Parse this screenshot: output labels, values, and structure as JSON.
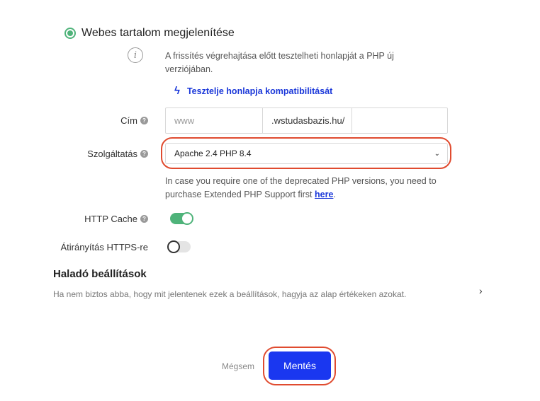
{
  "content_option": {
    "label": "Webes tartalom megjelenítése",
    "selected": true
  },
  "info": {
    "icon": "info-icon",
    "text": "A frissítés végrehajtása előtt tesztelheti honlapját a PHP új verziójában."
  },
  "compat_link": {
    "icon": "lightning-icon",
    "label": "Tesztelje honlapja kompatibilitását"
  },
  "cim": {
    "label": "Cím",
    "subdomain_placeholder": "www",
    "domain": ".wstudasbazis.hu/"
  },
  "service": {
    "label": "Szolgáltatás",
    "selected": "Apache 2.4 PHP 8.4"
  },
  "deprecated_note": {
    "text": "In case you require one of the deprecated PHP versions, you need to purchase Extended PHP Support first ",
    "link": "here",
    "end": "."
  },
  "http_cache": {
    "label": "HTTP Cache",
    "enabled": true
  },
  "https_redirect": {
    "label": "Átirányítás HTTPS-re",
    "enabled": false
  },
  "advanced": {
    "title": "Haladó beállítások",
    "description": "Ha nem biztos abba, hogy mit jelentenek ezek a beállítások, hagyja az alap értékeken azokat."
  },
  "buttons": {
    "cancel": "Mégsem",
    "save": "Mentés"
  },
  "colors": {
    "accent": "#1a37f0",
    "success": "#4fb37a",
    "highlight": "#e04b2f"
  }
}
